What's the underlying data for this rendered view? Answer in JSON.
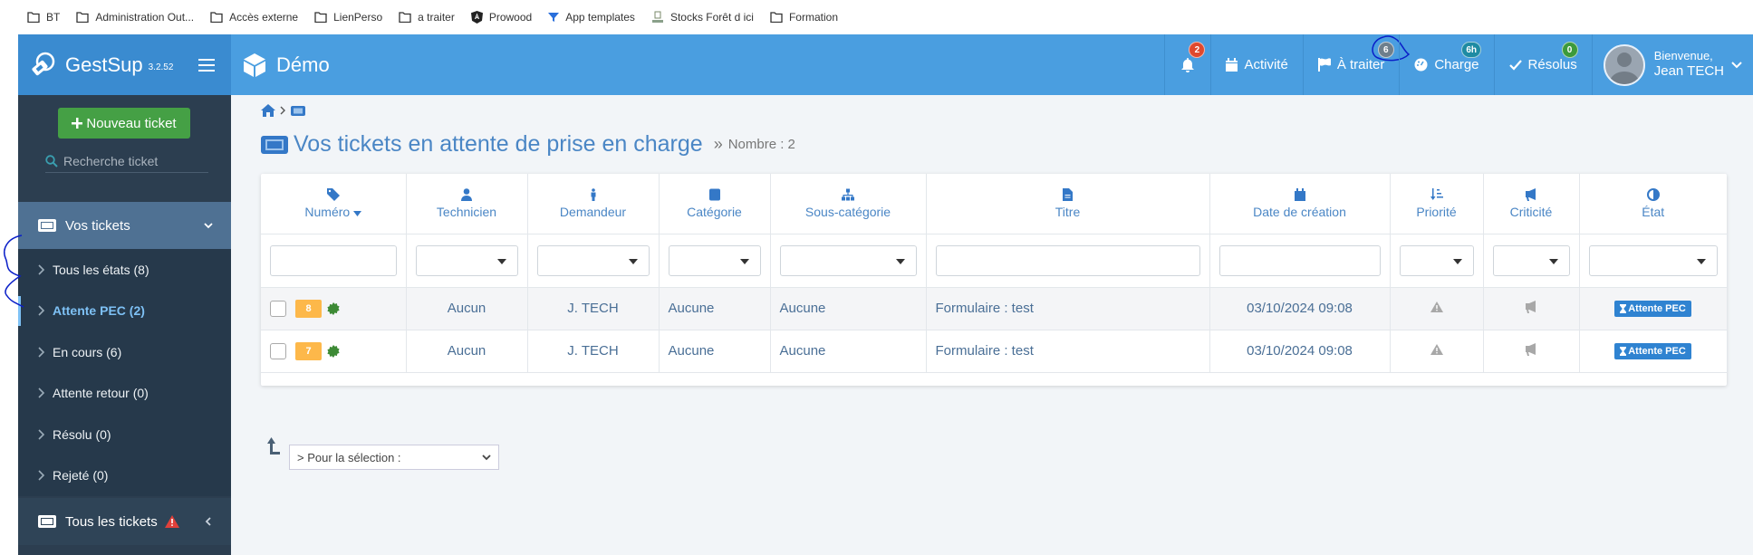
{
  "bookmarks": [
    {
      "label": "BT",
      "icon": "folder-icon"
    },
    {
      "label": "Administration Out...",
      "icon": "folder-icon"
    },
    {
      "label": "Accès externe",
      "icon": "folder-icon"
    },
    {
      "label": "LienPerso",
      "icon": "folder-icon"
    },
    {
      "label": "a traiter",
      "icon": "folder-icon"
    },
    {
      "label": "Prowood",
      "icon": "angular-icon"
    },
    {
      "label": "App templates",
      "icon": "funnel-icon"
    },
    {
      "label": "Stocks Forêt d ici",
      "icon": "site-icon"
    },
    {
      "label": "Formation",
      "icon": "folder-icon"
    }
  ],
  "header": {
    "brand": "GestSup",
    "version": "3.2.52",
    "project": "Démo",
    "notifications_count": "2",
    "nav": [
      {
        "label": "Activité",
        "icon": "calendar-icon",
        "badge": ""
      },
      {
        "label": "À traiter",
        "icon": "flag-icon",
        "badge": "6"
      },
      {
        "label": "Charge",
        "icon": "gauge-icon",
        "badge": "6h"
      },
      {
        "label": "Résolus",
        "icon": "check-icon",
        "badge": "0"
      }
    ],
    "user_greeting": "Bienvenue,",
    "user_name": "Jean TECH"
  },
  "colors": {
    "header": "#4a9ee0",
    "sidebar": "#2c3e50",
    "accent": "#4a86c5",
    "badge_red": "#e0492e",
    "badge_grey": "#6e7f8c",
    "badge_teal": "#1e8ba3",
    "badge_green": "#3c9a3c",
    "ticket_number": "#fdb84a",
    "state_badge": "#2f83d1"
  },
  "sidebar": {
    "new_ticket": "Nouveau ticket",
    "search_placeholder": "Recherche ticket",
    "section": "Vos tickets",
    "items": [
      {
        "label": "Tous les états (8)",
        "active": false
      },
      {
        "label": "Attente PEC (2)",
        "active": true
      },
      {
        "label": "En cours (6)",
        "active": false
      },
      {
        "label": "Attente retour (0)",
        "active": false
      },
      {
        "label": "Résolu (0)",
        "active": false
      },
      {
        "label": "Rejeté (0)",
        "active": false
      }
    ],
    "all_tickets": "Tous les tickets"
  },
  "main": {
    "title": "Vos tickets en attente de prise en charge",
    "count_label": "Nombre : 2",
    "separator": "»",
    "columns": [
      {
        "label": "Numéro",
        "icon": "tag-icon",
        "sorted": "desc"
      },
      {
        "label": "Technicien",
        "icon": "user-icon"
      },
      {
        "label": "Demandeur",
        "icon": "person-icon"
      },
      {
        "label": "Catégorie",
        "icon": "square-icon"
      },
      {
        "label": "Sous-catégorie",
        "icon": "sitemap-icon"
      },
      {
        "label": "Titre",
        "icon": "file-icon"
      },
      {
        "label": "Date de création",
        "icon": "calendar-icon"
      },
      {
        "label": "Priorité",
        "icon": "sort-priority-icon"
      },
      {
        "label": "Criticité",
        "icon": "bullhorn-icon"
      },
      {
        "label": "État",
        "icon": "adjust-icon"
      }
    ],
    "rows": [
      {
        "number": "8",
        "technician": "Aucun",
        "requester": "J. TECH",
        "category": "Aucune",
        "subcategory": "Aucune",
        "title": "Formulaire : test",
        "created": "03/10/2024 09:08",
        "state": "Attente PEC"
      },
      {
        "number": "7",
        "technician": "Aucun",
        "requester": "J. TECH",
        "category": "Aucune",
        "subcategory": "Aucune",
        "title": "Formulaire : test",
        "created": "03/10/2024 09:08",
        "state": "Attente PEC"
      }
    ],
    "selection_action": "> Pour la sélection :"
  }
}
